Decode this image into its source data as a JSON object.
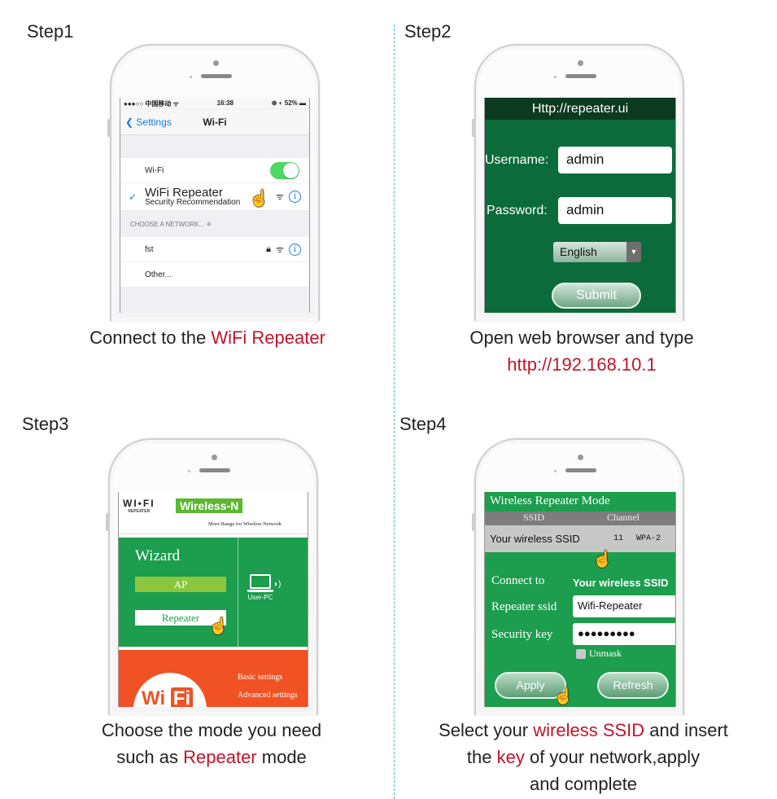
{
  "steps": [
    {
      "title": "Step1",
      "caption": {
        "prefix": "Connect to the ",
        "highlight": "WiFi Repeater"
      },
      "screen": {
        "status_bar": {
          "carrier": "●●●○○ 中国移动 ᯤ",
          "time": "16:38",
          "battery": "⊕ ◐ 52% ▬"
        },
        "nav": {
          "back_label": "Settings",
          "title": "Wi-Fi"
        },
        "wifi_toggle": {
          "label": "Wi-Fi",
          "on": true
        },
        "connected_network": {
          "name": "WiFi Repeater",
          "subtitle": "Security Recommendation"
        },
        "section_header": "CHOOSE A NETWORK...",
        "networks": [
          {
            "name": "fst",
            "locked": true
          },
          {
            "name": "Other..."
          }
        ]
      }
    },
    {
      "title": "Step2",
      "caption": {
        "line1": "Open web browser and type",
        "highlight": "http://192.168.10.1"
      },
      "screen": {
        "header": "Http://repeater.ui",
        "username_label": "Username:",
        "username_value": "admin",
        "password_label": "Password:",
        "password_value": "admin",
        "language": "English",
        "submit_label": "Submit"
      }
    },
    {
      "title": "Step3",
      "caption": {
        "line1": "Choose the mode you need",
        "prefix2": "such as ",
        "highlight": "Repeater",
        "suffix2": " mode"
      },
      "screen": {
        "logo_text": "WI•FI",
        "logo_sub": "REPEATER",
        "badge": "Wireless-N",
        "tagline": "More Range for Wireless Network",
        "wizard_title": "Wizard",
        "mode_ap": "AP",
        "mode_repeater": "Repeater",
        "pc_label": "User-PC",
        "wifi_logo": {
          "left": "Wi",
          "right": "Fi"
        },
        "menu": [
          "Basic settings",
          "Advanced settings"
        ]
      }
    },
    {
      "title": "Step4",
      "caption": {
        "prefix1": "Select your ",
        "highlight1": "wireless SSID",
        "suffix1": " and insert",
        "prefix2": "the ",
        "highlight2": "key",
        "suffix2": " of your network,apply",
        "line3": "and complete"
      },
      "screen": {
        "title": "Wireless Repeater Mode",
        "table_headers": [
          "SSID",
          "Channel"
        ],
        "table_row": {
          "ssid": "Your wireless SSID",
          "channel": "11",
          "security": "WPA-2"
        },
        "connect_label": "Connect to",
        "connect_value": "Your wireless SSID",
        "repeater_ssid_label": "Repeater ssid",
        "repeater_ssid_value": "Wifi-Repeater",
        "security_key_label": "Security key",
        "security_key_value": "●●●●●●●●●",
        "unmask_label": "Unmask",
        "apply_label": "Apply",
        "refresh_label": "Refresh"
      }
    }
  ],
  "colors": {
    "highlight": "#c0142a",
    "divider": "#4fb3d6",
    "router_green": "#1d9d4e",
    "login_green": "#0c6b3a",
    "orange": "#f05223"
  }
}
